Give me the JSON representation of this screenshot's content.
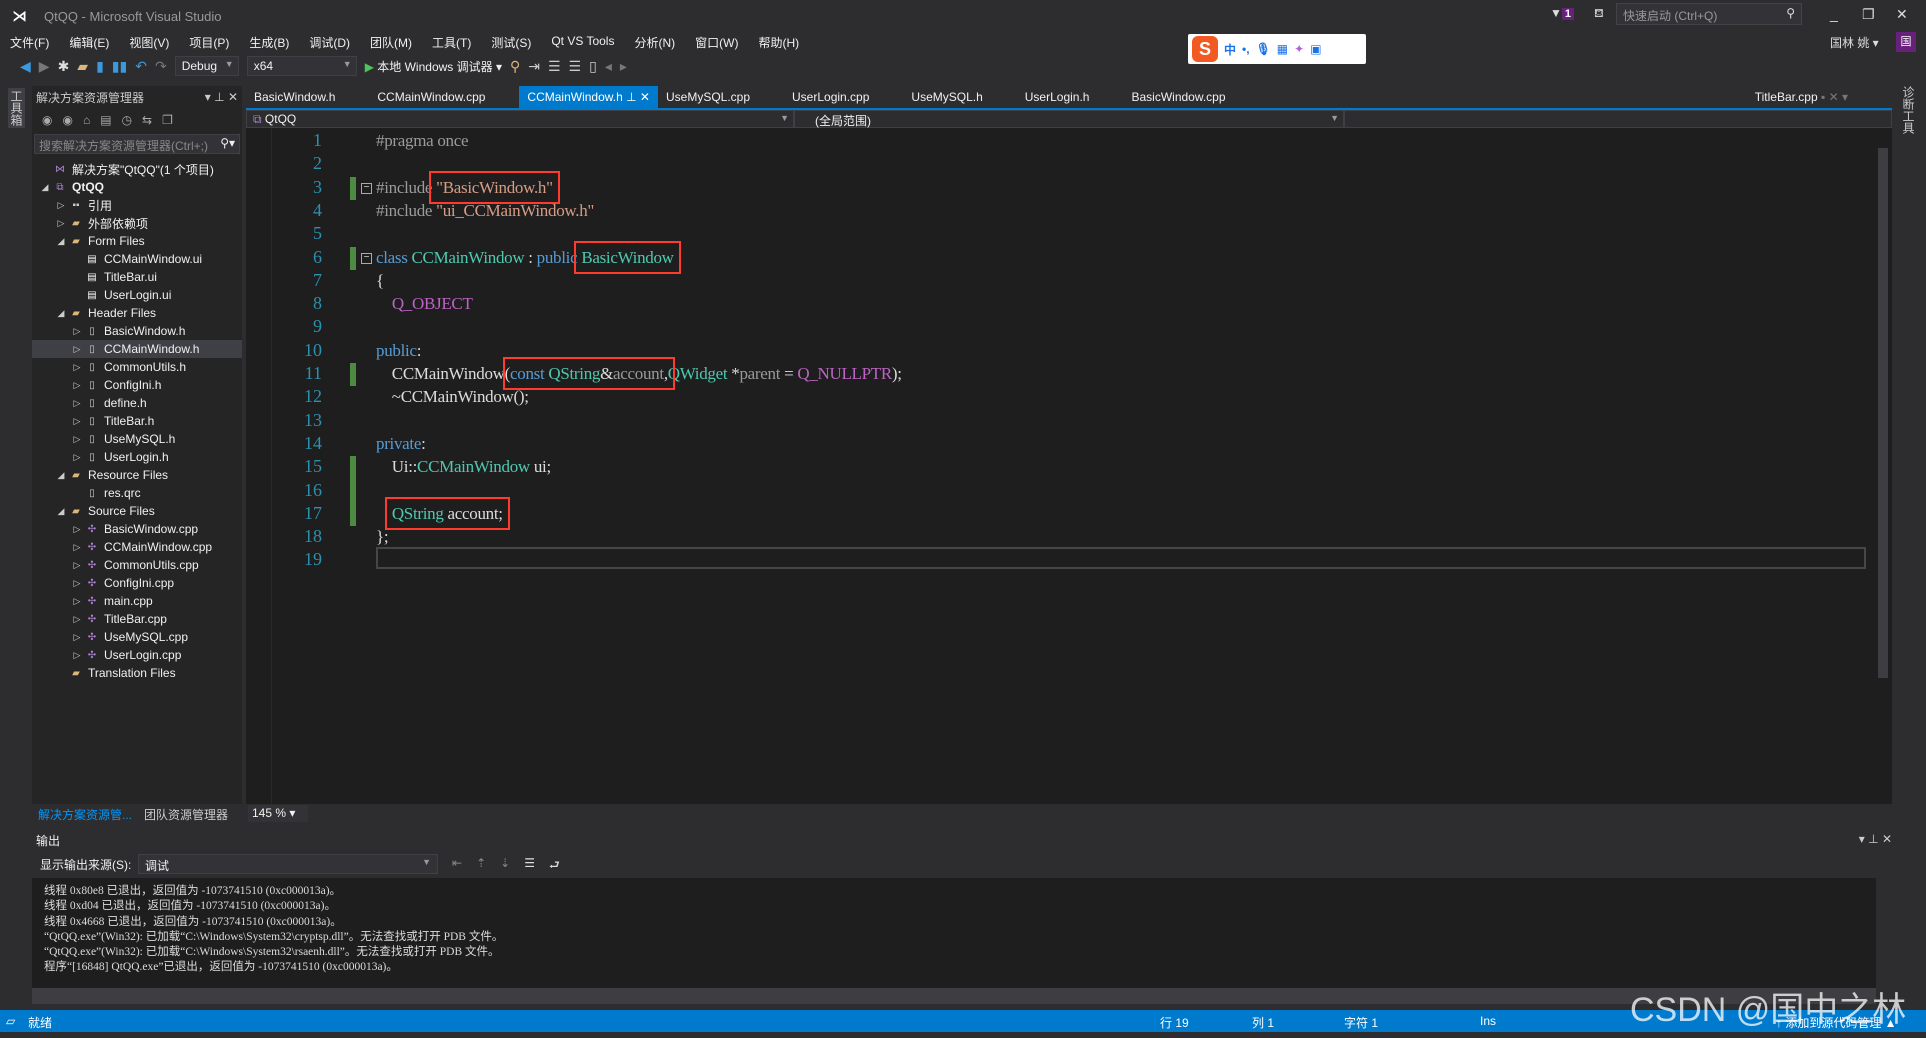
{
  "window": {
    "title": "QtQQ - Microsoft Visual Studio",
    "quick_launch_placeholder": "快速启动 (Ctrl+Q)",
    "notification_count": "1",
    "user": "国林 姚",
    "avatar_letter": "国"
  },
  "ime": {
    "lang": "中",
    "punct": "•,"
  },
  "menu": [
    "文件(F)",
    "编辑(E)",
    "视图(V)",
    "项目(P)",
    "生成(B)",
    "调试(D)",
    "团队(M)",
    "工具(T)",
    "测试(S)",
    "Qt VS Tools",
    "分析(N)",
    "窗口(W)",
    "帮助(H)"
  ],
  "toolbar": {
    "config": "Debug",
    "platform": "x64",
    "run": "本地 Windows 调试器"
  },
  "side_left": "工具箱",
  "side_right": "诊断工具",
  "solution_explorer": {
    "title": "解决方案资源管理器",
    "search_placeholder": "搜索解决方案资源管理器(Ctrl+;)",
    "tree": [
      {
        "label": "解决方案\"QtQQ\"(1 个项目)",
        "level": 0,
        "arrow": "",
        "icon": "solution"
      },
      {
        "label": "QtQQ",
        "level": 0,
        "arrow": "◢",
        "icon": "proj",
        "bold": true
      },
      {
        "label": "引用",
        "level": 1,
        "arrow": "▷",
        "icon": "ref"
      },
      {
        "label": "外部依赖项",
        "level": 1,
        "arrow": "▷",
        "icon": "folder"
      },
      {
        "label": "Form Files",
        "level": 1,
        "arrow": "◢",
        "icon": "folder"
      },
      {
        "label": "CCMainWindow.ui",
        "level": 2,
        "arrow": "",
        "icon": "ui"
      },
      {
        "label": "TitleBar.ui",
        "level": 2,
        "arrow": "",
        "icon": "ui"
      },
      {
        "label": "UserLogin.ui",
        "level": 2,
        "arrow": "",
        "icon": "ui"
      },
      {
        "label": "Header Files",
        "level": 1,
        "arrow": "◢",
        "icon": "folder"
      },
      {
        "label": "BasicWindow.h",
        "level": 2,
        "arrow": "▷",
        "icon": "h"
      },
      {
        "label": "CCMainWindow.h",
        "level": 2,
        "arrow": "▷",
        "icon": "h",
        "selected": true
      },
      {
        "label": "CommonUtils.h",
        "level": 2,
        "arrow": "▷",
        "icon": "h"
      },
      {
        "label": "ConfigIni.h",
        "level": 2,
        "arrow": "▷",
        "icon": "h"
      },
      {
        "label": "define.h",
        "level": 2,
        "arrow": "▷",
        "icon": "h"
      },
      {
        "label": "TitleBar.h",
        "level": 2,
        "arrow": "▷",
        "icon": "h"
      },
      {
        "label": "UseMySQL.h",
        "level": 2,
        "arrow": "▷",
        "icon": "h"
      },
      {
        "label": "UserLogin.h",
        "level": 2,
        "arrow": "▷",
        "icon": "h"
      },
      {
        "label": "Resource Files",
        "level": 1,
        "arrow": "◢",
        "icon": "folder"
      },
      {
        "label": "res.qrc",
        "level": 2,
        "arrow": "",
        "icon": "h"
      },
      {
        "label": "Source Files",
        "level": 1,
        "arrow": "◢",
        "icon": "folder"
      },
      {
        "label": "BasicWindow.cpp",
        "level": 2,
        "arrow": "▷",
        "icon": "cpp"
      },
      {
        "label": "CCMainWindow.cpp",
        "level": 2,
        "arrow": "▷",
        "icon": "cpp"
      },
      {
        "label": "CommonUtils.cpp",
        "level": 2,
        "arrow": "▷",
        "icon": "cpp"
      },
      {
        "label": "ConfigIni.cpp",
        "level": 2,
        "arrow": "▷",
        "icon": "cpp"
      },
      {
        "label": "main.cpp",
        "level": 2,
        "arrow": "▷",
        "icon": "cpp"
      },
      {
        "label": "TitleBar.cpp",
        "level": 2,
        "arrow": "▷",
        "icon": "cpp"
      },
      {
        "label": "UseMySQL.cpp",
        "level": 2,
        "arrow": "▷",
        "icon": "cpp"
      },
      {
        "label": "UserLogin.cpp",
        "level": 2,
        "arrow": "▷",
        "icon": "cpp"
      },
      {
        "label": "Translation Files",
        "level": 1,
        "arrow": "",
        "icon": "folder"
      }
    ],
    "bottom_tabs": [
      "解决方案资源管...",
      "团队资源管理器"
    ]
  },
  "editor": {
    "tabs": [
      "BasicWindow.h",
      "CCMainWindow.cpp",
      "CCMainWindow.h",
      "UseMySQL.cpp",
      "UserLogin.cpp",
      "UseMySQL.h",
      "UserLogin.h",
      "BasicWindow.cpp"
    ],
    "active_tab": 2,
    "right_tab": "TitleBar.cpp",
    "nav_project": "QtQQ",
    "nav_scope": "(全局范围)",
    "zoom": "145 %",
    "lines": [
      [
        [
          "#pragma once",
          "pp"
        ]
      ],
      [],
      [
        [
          "#include ",
          "pp"
        ],
        [
          "\"BasicWindow.h\"",
          "str"
        ]
      ],
      [
        [
          "#include ",
          "pp"
        ],
        [
          "\"ui_CCMainWindow.h\"",
          "str"
        ]
      ],
      [],
      [
        [
          "class ",
          "kw"
        ],
        [
          "CCMainWindow",
          "ty"
        ],
        [
          " : ",
          ""
        ],
        [
          "public ",
          "kw"
        ],
        [
          "BasicWindow",
          "ty"
        ]
      ],
      [
        [
          "{",
          ""
        ]
      ],
      [
        [
          "    ",
          ""
        ],
        [
          "Q_OBJECT",
          "mac"
        ]
      ],
      [],
      [
        [
          "public",
          "kw"
        ],
        [
          ":",
          ""
        ]
      ],
      [
        [
          "    CCMainWindow",
          ""
        ],
        [
          "(",
          ""
        ],
        [
          "const ",
          "kw"
        ],
        [
          "QString",
          "ty"
        ],
        [
          "&",
          ""
        ],
        [
          "account",
          "par"
        ],
        [
          ",",
          ""
        ],
        [
          "QWidget",
          "ty"
        ],
        [
          " *",
          ""
        ],
        [
          "parent",
          "par"
        ],
        [
          " = ",
          ""
        ],
        [
          "Q_NULLPTR",
          "mac"
        ],
        [
          ");",
          ""
        ]
      ],
      [
        [
          "    ~CCMainWindow();",
          ""
        ]
      ],
      [],
      [
        [
          "private",
          "kw"
        ],
        [
          ":",
          ""
        ]
      ],
      [
        [
          "    Ui::",
          ""
        ],
        [
          "CCMainWindow",
          "ty"
        ],
        [
          " ui;",
          ""
        ]
      ],
      [],
      [
        [
          "    ",
          ""
        ],
        [
          "QString",
          "ty"
        ],
        [
          " account;",
          ""
        ]
      ],
      [
        [
          "};",
          ""
        ]
      ],
      []
    ]
  },
  "output": {
    "title": "输出",
    "source_label": "显示输出来源(S):",
    "source_value": "调试",
    "lines": [
      "线程 0x80e8 已退出，返回值为 -1073741510 (0xc000013a)。",
      "线程 0xd04 已退出，返回值为 -1073741510 (0xc000013a)。",
      "线程 0x4668 已退出，返回值为 -1073741510 (0xc000013a)。",
      "“QtQQ.exe”(Win32): 已加载“C:\\Windows\\System32\\cryptsp.dll”。无法查找或打开 PDB 文件。",
      "“QtQQ.exe”(Win32): 已加载“C:\\Windows\\System32\\rsaenh.dll”。无法查找或打开 PDB 文件。",
      "程序“[16848] QtQQ.exe”已退出，返回值为 -1073741510 (0xc000013a)。"
    ]
  },
  "status": {
    "ready": "就绪",
    "line": "行 19",
    "col": "列 1",
    "char": "字符 1",
    "mode": "Ins",
    "source_control": "↑ 添加到源代码管理 ▲"
  },
  "watermark": "CSDN @国中之林",
  "colors": {
    "accent": "#007acc",
    "highlight_box": "#ff3b30",
    "keyword": "#569cd6",
    "type": "#4ec9b0",
    "string": "#d69d85",
    "macro": "#bd63c5"
  }
}
